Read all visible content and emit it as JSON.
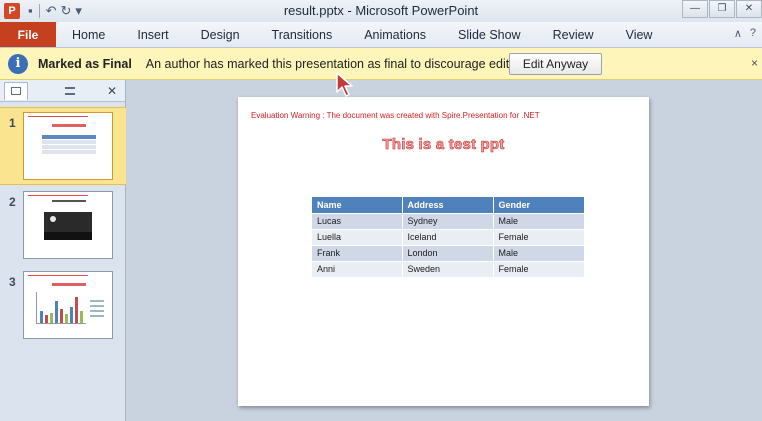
{
  "window": {
    "title": "result.pptx  -  Microsoft PowerPoint",
    "app_icon_letter": "P",
    "qat": {
      "undo": "↶",
      "redo": "↻",
      "customize": "▾"
    },
    "controls": {
      "minimize": "—",
      "restore": "❐",
      "close": "✕"
    }
  },
  "ribbon": {
    "file_tab": "File",
    "tabs": [
      "Home",
      "Insert",
      "Design",
      "Transitions",
      "Animations",
      "Slide Show",
      "Review",
      "View"
    ],
    "minimize_ribbon": "∧",
    "help": "?"
  },
  "message_bar": {
    "icon": "i",
    "title": "Marked as Final",
    "text": "An author has marked this presentation as final to discourage editing.",
    "button": "Edit Anyway",
    "close": "×"
  },
  "slides_panel": {
    "close": "✕",
    "thumbnails": [
      {
        "number": "1",
        "kind": "table",
        "selected": true
      },
      {
        "number": "2",
        "kind": "image",
        "selected": false
      },
      {
        "number": "3",
        "kind": "chart",
        "selected": false
      }
    ]
  },
  "slide": {
    "eval_warning": "Evaluation Warning : The document was created with  Spire.Presentation for .NET",
    "title": "This is  a test ppt",
    "table": {
      "headers": [
        "Name",
        "Address",
        "Gender"
      ],
      "rows": [
        [
          "Lucas",
          "Sydney",
          "Male"
        ],
        [
          "Luella",
          "Iceland",
          "Female"
        ],
        [
          "Frank",
          "London",
          "Male"
        ],
        [
          "Anni",
          "Sweden",
          "Female"
        ]
      ]
    }
  },
  "colors": {
    "file_tab": "#c4401f",
    "message_bar": "#fdf5ba",
    "table_header": "#4f81bd",
    "warning_text": "#d42222",
    "selected_thumb": "#fbe48f"
  }
}
